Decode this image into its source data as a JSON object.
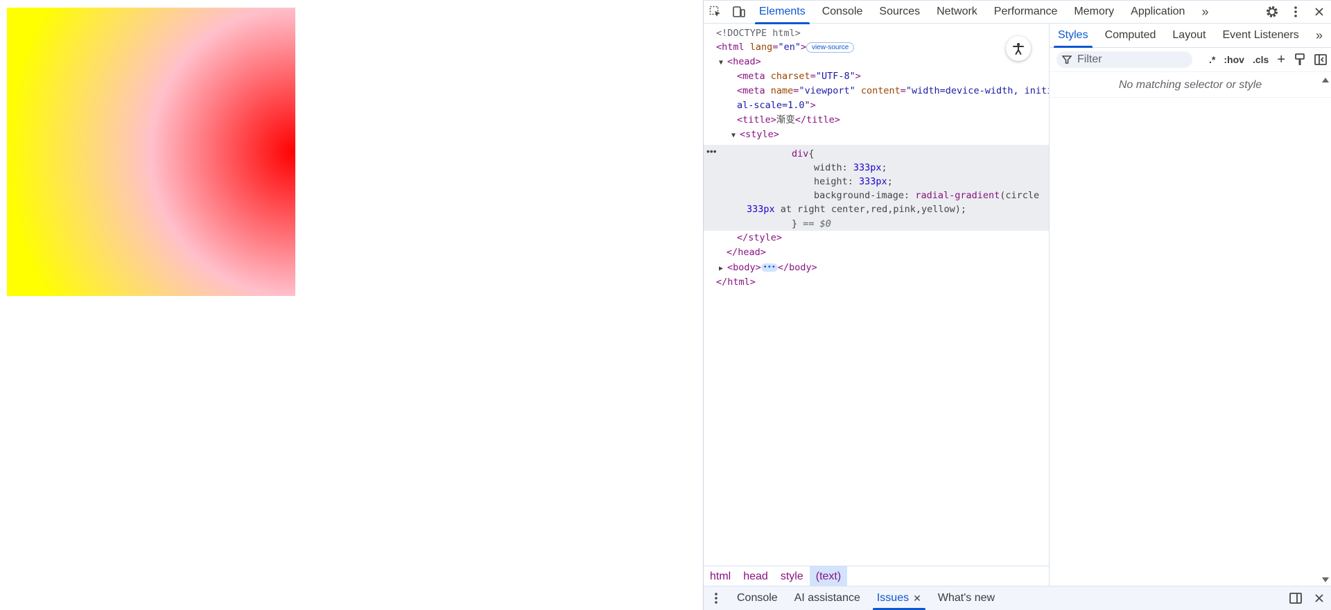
{
  "devtools": {
    "main_tabs": [
      "Elements",
      "Console",
      "Sources",
      "Network",
      "Performance",
      "Memory",
      "Application"
    ],
    "active_main_tab": "Elements",
    "more_tabs_label": "»",
    "code": {
      "doctype": "<!DOCTYPE html>",
      "html_open_tag": "html",
      "html_lang_attr": "lang",
      "html_lang_val": "\"en\"",
      "view_source_label": "view-source",
      "head_tag": "head",
      "meta1_attr": "charset",
      "meta1_val": "\"UTF-8\"",
      "meta2_name_attr": "name",
      "meta2_name_val": "\"viewport\"",
      "meta2_content_attr": "content",
      "meta2_content_val_1": "\"width=device-width, initi",
      "meta2_content_val_2": "al-scale=1.0\"",
      "title_text": "渐变",
      "style_tag": "style",
      "css_selector": "div",
      "css_width_prop": "width",
      "css_width_val": "333px",
      "css_height_prop": "height",
      "css_height_val": "333px",
      "css_bg_prop": "background-image",
      "css_bg_fn": "radial-gradient",
      "css_bg_args_1": "(circle",
      "css_bg_size": "333px",
      "css_bg_args_2": "at right center,red,pink,yellow);",
      "selected_marker": "== $0",
      "body_tag": "body"
    },
    "breadcrumb": [
      "html",
      "head",
      "style",
      "(text)"
    ],
    "styles_tabs": [
      "Styles",
      "Computed",
      "Layout",
      "Event Listeners"
    ],
    "active_styles_tab": "Styles",
    "filter_placeholder": "Filter",
    "filter_actions": [
      ".*",
      ":hov",
      ".cls",
      "+"
    ],
    "no_match_text": "No matching selector or style",
    "drawer_tabs": [
      "Console",
      "AI assistance",
      "Issues",
      "What's new"
    ],
    "active_drawer_tab": "Issues"
  }
}
